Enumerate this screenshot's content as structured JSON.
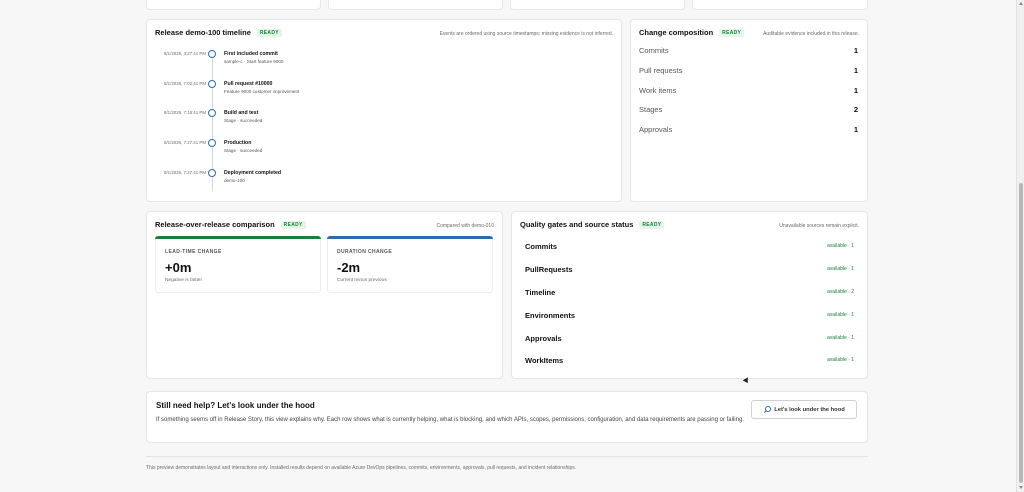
{
  "timeline": {
    "title": "Release demo-100 timeline",
    "badge": "READY",
    "hint": "Events are ordered using source timestamps; missing evidence is not inferred.",
    "events": [
      {
        "time": "8/1/2026, 3:27:41 PM",
        "title": "First included commit",
        "sub": "sample-c · Start feature 9000"
      },
      {
        "time": "8/1/2026, 7:02:41 PM",
        "title": "Pull request #10000",
        "sub": "Feature 9000 customer improvement"
      },
      {
        "time": "8/1/2026, 7:18:41 PM",
        "title": "Build and test",
        "sub": "Stage · succeeded"
      },
      {
        "time": "8/1/2026, 7:27:41 PM",
        "title": "Production",
        "sub": "Stage · succeeded"
      },
      {
        "time": "8/1/2026, 7:27:41 PM",
        "title": "Deployment completed",
        "sub": "demo-100"
      }
    ]
  },
  "composition": {
    "title": "Change composition",
    "badge": "READY",
    "hint": "Auditable evidence included in this release.",
    "rows": [
      {
        "label": "Commits",
        "value": "1"
      },
      {
        "label": "Pull requests",
        "value": "1"
      },
      {
        "label": "Work items",
        "value": "1"
      },
      {
        "label": "Stages",
        "value": "2"
      },
      {
        "label": "Approvals",
        "value": "1"
      }
    ]
  },
  "comparison": {
    "title": "Release-over-release comparison",
    "badge": "READY",
    "hint": "Compared with demo-010",
    "metrics": [
      {
        "label": "LEAD-TIME CHANGE",
        "value": "+0m",
        "note": "Negative is faster",
        "color": "#1a7f37"
      },
      {
        "label": "DURATION CHANGE",
        "value": "-2m",
        "note": "Current minus previous",
        "color": "#2b6cb0"
      }
    ]
  },
  "quality": {
    "title": "Quality gates and source status",
    "badge": "READY",
    "hint": "Unavailable sources remain explicit.",
    "rows": [
      {
        "name": "Commits",
        "status": "available · 1"
      },
      {
        "name": "PullRequests",
        "status": "available · 1"
      },
      {
        "name": "Timeline",
        "status": "available · 2"
      },
      {
        "name": "Environments",
        "status": "available · 1"
      },
      {
        "name": "Approvals",
        "status": "available · 1"
      },
      {
        "name": "WorkItems",
        "status": "available · 1"
      }
    ]
  },
  "help": {
    "title": "Still need help? Let's look under the hood",
    "body": "If something seems off in Release Story, this view explains why. Each row shows what is currently helping, what is blocking, and which APIs, scopes, permissions, configuration, and data requirements are passing or failing.",
    "button": "Let's look under the hood"
  },
  "footer": "This preview demonstrates layout and interactions only. Installed results depend on available Azure DevOps pipelines, commits, environments, approvals, pull requests, and incident relationships."
}
